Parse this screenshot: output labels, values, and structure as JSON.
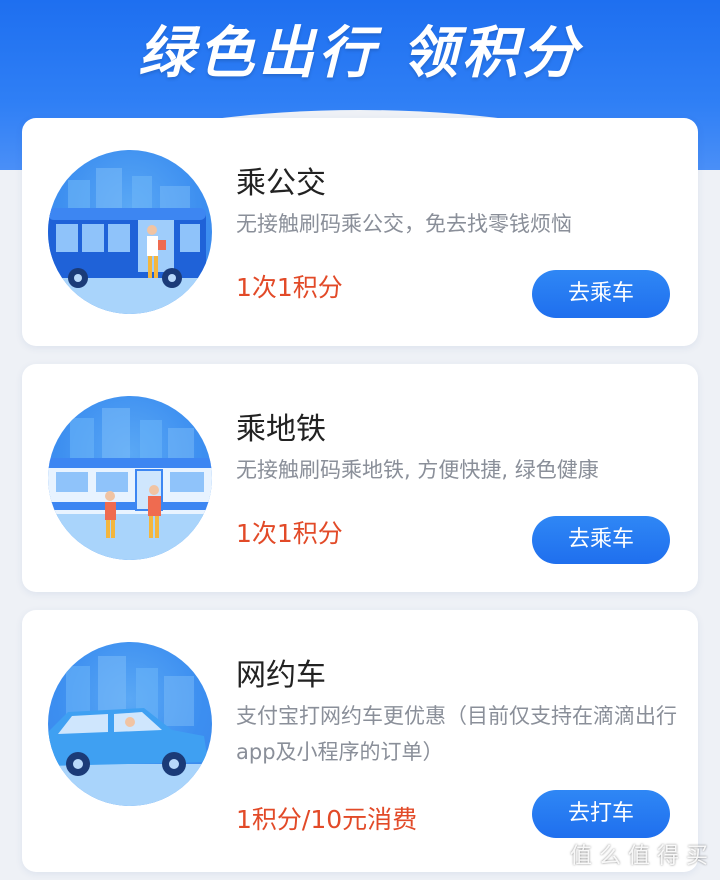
{
  "header": {
    "title": "绿色出行 领积分"
  },
  "cards": [
    {
      "title": "乘公交",
      "desc": "无接触刷码乘公交，免去找零钱烦恼",
      "points": "1次1积分",
      "button": "去乘车",
      "illustration": "bus-illustration"
    },
    {
      "title": "乘地铁",
      "desc": "无接触刷码乘地铁, 方便快捷, 绿色健康",
      "points": "1次1积分",
      "button": "去乘车",
      "illustration": "subway-illustration"
    },
    {
      "title": "网约车",
      "desc": "支付宝打网约车更优惠（目前仅支持在滴滴出行app及小程序的订单）",
      "points": "1积分/10元消费",
      "button": "去打车",
      "illustration": "car-illustration"
    }
  ],
  "watermark": "值 么 值 得 买",
  "colors": {
    "primary": "#2a7cf2",
    "points_red": "#e24a28",
    "desc_gray": "#8a8f99",
    "title_dark": "#222222",
    "background": "#eef1f6"
  }
}
